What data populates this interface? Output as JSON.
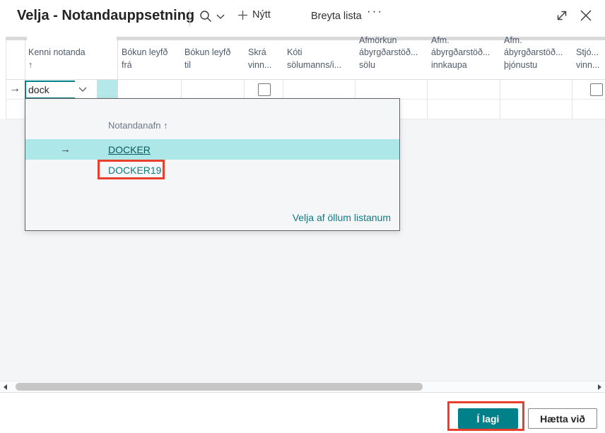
{
  "window": {
    "title": "Velja - Notandauppsetning",
    "toolbar": {
      "new_label": "Nýtt",
      "edit_list_label": "Breyta lista",
      "more_glyph": "···"
    }
  },
  "grid": {
    "columns": [
      {
        "lines": [
          "Kenni notanda",
          "↑"
        ]
      },
      {
        "lines": [
          "Bókun leyfð",
          "frá"
        ]
      },
      {
        "lines": [
          "Bókun leyfð",
          "til"
        ]
      },
      {
        "lines": [
          "Skrá",
          "vinn..."
        ]
      },
      {
        "lines": [
          "Kóti",
          "sölumanns/i..."
        ]
      },
      {
        "lines": [
          "Afmörkun",
          "ábyrgðarstöð...",
          "sölu"
        ]
      },
      {
        "lines": [
          "Afm.",
          "ábyrgðarstöð...",
          "innkaupa"
        ]
      },
      {
        "lines": [
          "Afm.",
          "ábyrgðarstöð...",
          "þjónustu"
        ]
      },
      {
        "lines": [
          "Stjó...",
          "vinn..."
        ]
      }
    ],
    "active_row": {
      "pointer": "→",
      "kenni_notanda_value": "dock",
      "skra_vinn_checked": false,
      "stjo_vinn_checked": false
    }
  },
  "lookup": {
    "column_header": "Notandanafn",
    "sort_arrow": "↑",
    "selected_pointer": "→",
    "items": [
      {
        "name": "DOCKER"
      },
      {
        "name": "DOCKER19"
      }
    ],
    "footer_link": "Velja af öllum listanum"
  },
  "footer": {
    "ok_label": "Í lagi",
    "cancel_label": "Hætta við"
  },
  "colors": {
    "accent_teal": "#008089",
    "selection_teal": "#ade7e8",
    "link_teal": "#0d7b84",
    "annotation_red": "#e8402c"
  }
}
